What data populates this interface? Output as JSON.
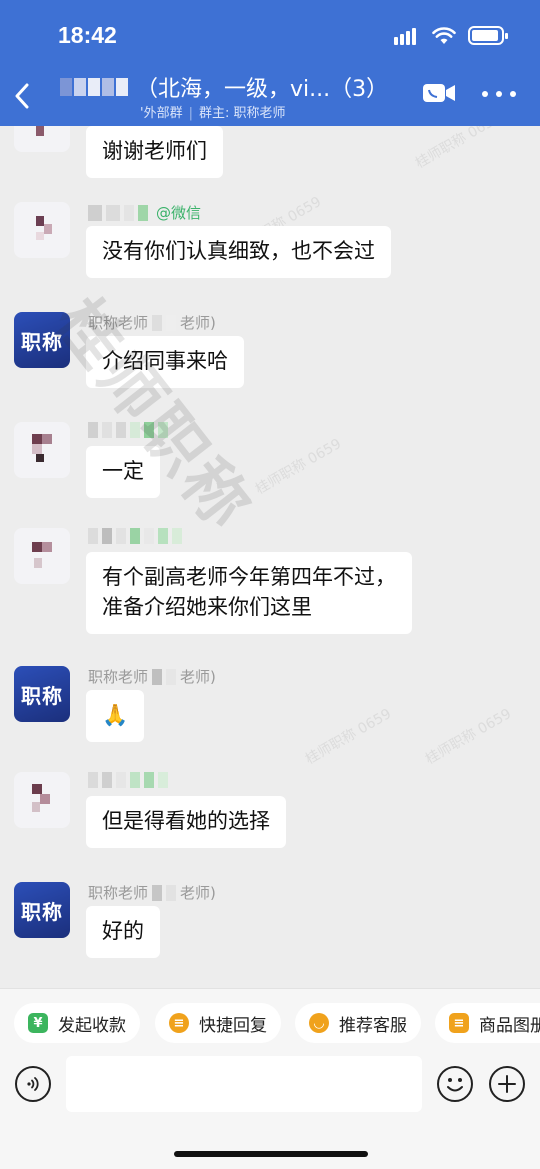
{
  "status_bar": {
    "time": "18:42"
  },
  "header": {
    "title": "（北海，一级，vi...（3）",
    "subtitle_left": "'外部群",
    "subtitle_right": "群主: 职称老师"
  },
  "messages": [
    {
      "sender": "",
      "text": "谢谢老师们"
    },
    {
      "sender": "@微信",
      "text": "没有你们认真细致，也不会过"
    },
    {
      "sender": "职称老师",
      "sender_suffix": "老师)",
      "text": "介绍同事来哈"
    },
    {
      "sender": "",
      "text": "一定"
    },
    {
      "sender": "",
      "text_line1": "有个副高老师今年第四年不过，",
      "text_line2": "准备介绍她来你们这里"
    },
    {
      "sender": "职称老师",
      "sender_suffix": "老师)",
      "text": "🙏"
    },
    {
      "sender": "",
      "text": "但是得看她的选择"
    },
    {
      "sender": "职称老师",
      "sender_suffix": "老师)",
      "text": "好的"
    }
  ],
  "avatar_brand_text": "职称",
  "watermark": {
    "main": "桂师职称",
    "small": "桂师职称 0659"
  },
  "quick_actions": [
    {
      "label": "发起收款",
      "icon_glyph": "¥",
      "color": "#3cb55e"
    },
    {
      "label": "快捷回复",
      "icon_glyph": "≡",
      "color": "#f0a21c"
    },
    {
      "label": "推荐客服",
      "icon_glyph": "◡",
      "color": "#f0a21c"
    },
    {
      "label": "商品图册",
      "icon_glyph": "≡",
      "color": "#f0a21c"
    }
  ],
  "input": {
    "placeholder": ""
  },
  "icons": [
    "back-icon",
    "video-call-icon",
    "more-icon",
    "voice-icon",
    "emoji-icon",
    "add-icon"
  ]
}
